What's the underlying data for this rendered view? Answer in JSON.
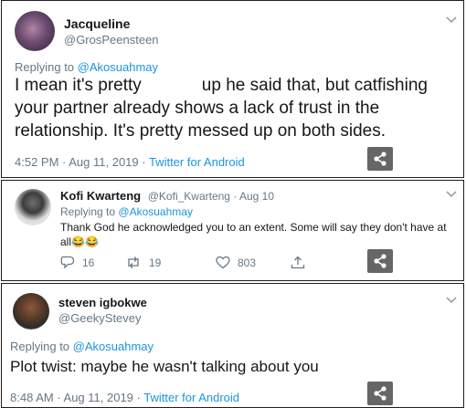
{
  "tweets": [
    {
      "name": "Jacqueline",
      "handle": "@GrosPeensteen",
      "replying_prefix": "Replying to",
      "replying_to": "@Akosuahmay",
      "text_a": "I mean it's pretty",
      "text_b": "up he said that, but catfishing your partner already shows a lack of trust in the relationship. It's pretty messed up on both sides.",
      "time": "4:52 PM · Aug 11, 2019 · ",
      "source": "Twitter for Android"
    },
    {
      "name": "Kofi Kwarteng",
      "handle": "@Kofi_Kwarteng · Aug 10",
      "replying_prefix": "Replying to",
      "replying_to": "@Akosuahmay",
      "text": "Thank God he acknowledged you to an extent. Some will say they don't have at all😂😂",
      "replies": "16",
      "retweets": "19",
      "likes": "803"
    },
    {
      "name": "steven igbokwe",
      "handle": "@GeekyStevey",
      "replying_prefix": "Replying to",
      "replying_to": "@Akosuahmay",
      "text": "Plot twist: maybe he wasn't talking about you",
      "time": "8:48 AM · Aug 11, 2019 · ",
      "source": "Twitter for Android"
    }
  ],
  "colors": {
    "link": "#1b95e0",
    "muted": "#657786",
    "text": "#14171a",
    "share_bg": "#666666"
  },
  "icons": [
    "chevron-down-icon",
    "share-icon",
    "reply-icon",
    "retweet-icon",
    "like-icon",
    "upload-icon"
  ]
}
